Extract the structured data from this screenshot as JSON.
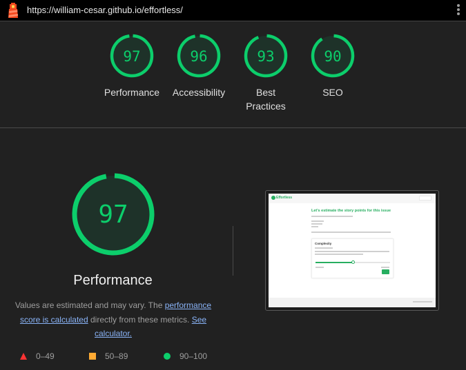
{
  "topbar": {
    "url": "https://william-cesar.github.io/effortless/",
    "logo_icon": "lighthouse-icon",
    "menu_icon": "more-vertical-icon"
  },
  "categories": [
    {
      "id": "performance",
      "label": "Performance",
      "score": 97,
      "color": "#0cce6b"
    },
    {
      "id": "accessibility",
      "label": "Accessibility",
      "score": 96,
      "color": "#0cce6b"
    },
    {
      "id": "best-practices",
      "label": "Best Practices",
      "score": 93,
      "color": "#0cce6b"
    },
    {
      "id": "seo",
      "label": "SEO",
      "score": 90,
      "color": "#0cce6b"
    }
  ],
  "performance_section": {
    "score": 97,
    "title": "Performance",
    "desc_prefix": "Values are estimated and may vary. The ",
    "desc_link1": "performance score is calculated",
    "desc_middle": " directly from these metrics. ",
    "desc_link2": "See calculator."
  },
  "legend": [
    {
      "icon": "fail-triangle-icon",
      "range": "0–49",
      "color": "#ff3333"
    },
    {
      "icon": "average-square-icon",
      "range": "50–89",
      "color": "#ffaa33"
    },
    {
      "icon": "pass-circle-icon",
      "range": "90–100",
      "color": "#0cce6b"
    }
  ],
  "screenshot": {
    "brand": "Effortless",
    "heading": "Let's estimate the story points for this issue",
    "card_title": "Complexity",
    "slider_fraction": 0.5
  },
  "colors": {
    "pass": "#0cce6b",
    "pass_bg": "#1e3229"
  }
}
